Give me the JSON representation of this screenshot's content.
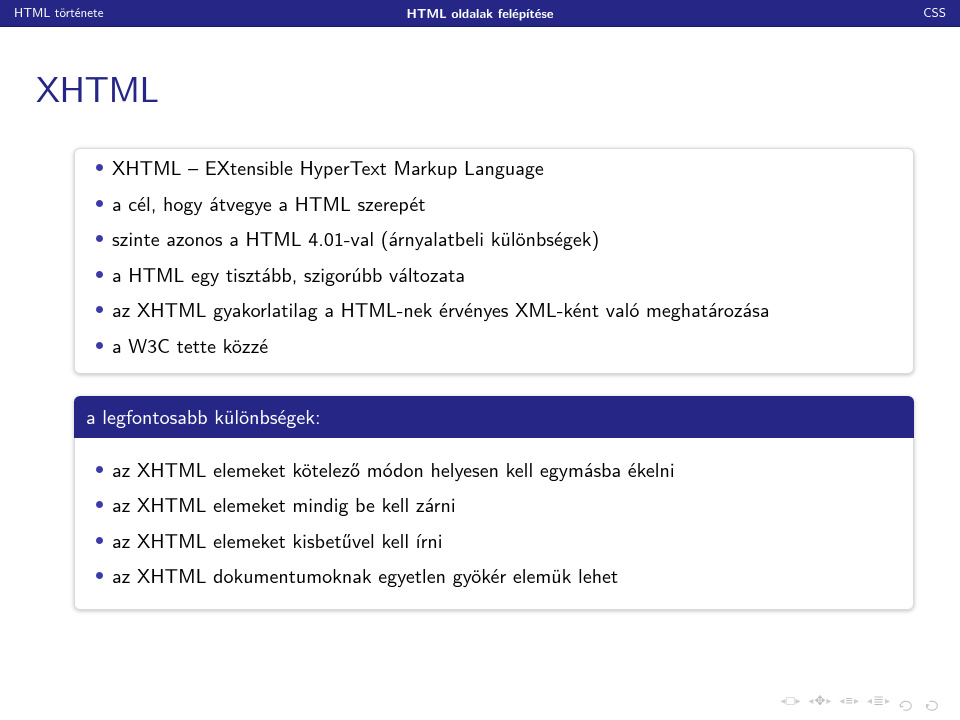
{
  "nav": {
    "left": "HTML története",
    "center": "HTML oldalak felépítése",
    "right": "CSS"
  },
  "title": "XHTML",
  "block1": {
    "items": [
      "XHTML – EXtensible HyperText Markup Language",
      "a cél, hogy átvegye a HTML szerepét",
      "szinte azonos a HTML 4.01-val (árnyalatbeli különbségek)",
      "a HTML egy tisztább, szigorúbb változata",
      "az XHTML gyakorlatilag a HTML-nek érvényes XML-ként való meghatározása",
      "a W3C tette közzé"
    ]
  },
  "block2": {
    "header": "a legfontosabb különbségek:",
    "items": [
      "az XHTML elemeket kötelező módon helyesen kell egymásba ékelni",
      "az XHTML elemeket mindig be kell zárni",
      "az XHTML elemeket kisbetűvel kell írni",
      "az XHTML dokumentumoknak egyetlen gyökér elemük lehet"
    ]
  }
}
